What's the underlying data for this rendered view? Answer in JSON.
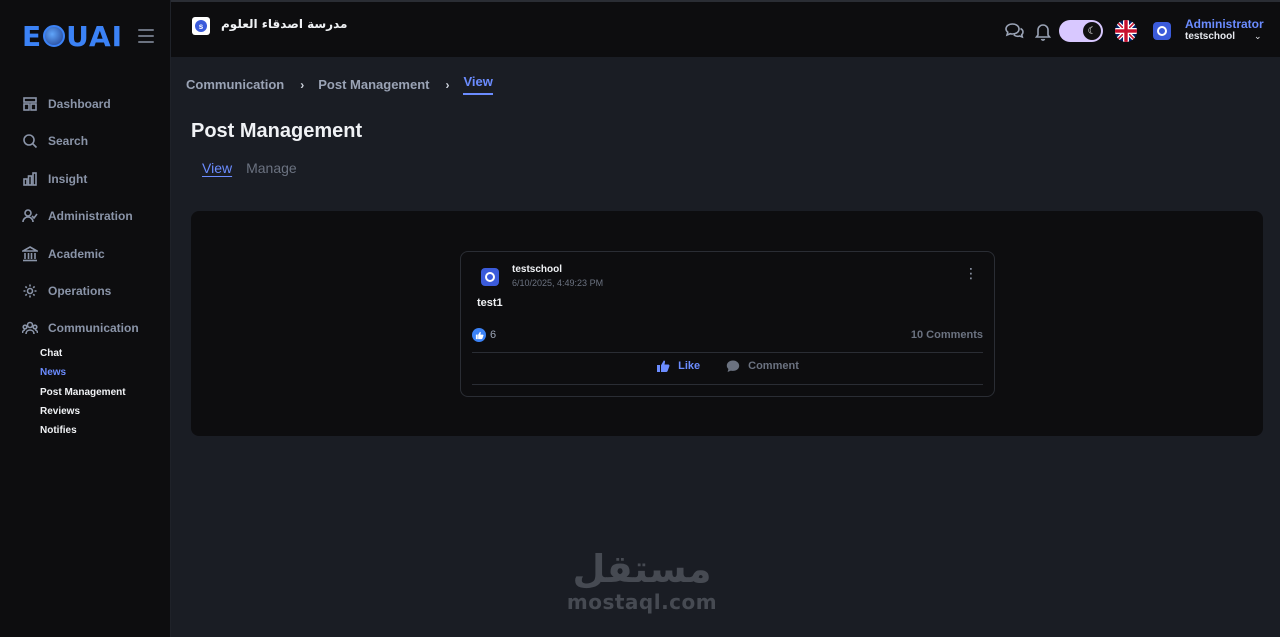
{
  "brand": {
    "logo_text_left": "E",
    "logo_text_right": "UAI"
  },
  "sidebar": {
    "items": [
      {
        "label": "Dashboard",
        "icon": "dashboard-icon"
      },
      {
        "label": "Search",
        "icon": "search-icon"
      },
      {
        "label": "Insight",
        "icon": "chart-icon"
      },
      {
        "label": "Administration",
        "icon": "user-check-icon"
      },
      {
        "label": "Academic",
        "icon": "bank-icon"
      },
      {
        "label": "Operations",
        "icon": "gear-icon"
      },
      {
        "label": "Communication",
        "icon": "users-icon"
      }
    ],
    "sub_items": [
      {
        "label": "Chat",
        "active": false
      },
      {
        "label": "News",
        "active": true
      },
      {
        "label": "Post Management",
        "active": false
      },
      {
        "label": "Reviews",
        "active": false
      },
      {
        "label": "Notifies",
        "active": false
      }
    ]
  },
  "topbar": {
    "school_name": "مدرسة اصدقاء العلوم",
    "user_role": "Administrator",
    "user_name": "testschool",
    "icons": [
      "chat-icon",
      "bell-icon",
      "moon-icon",
      "uk-flag-icon",
      "avatar-icon",
      "chevron-down-icon"
    ]
  },
  "breadcrumb": [
    "Communication",
    "Post Management",
    "View"
  ],
  "page": {
    "title": "Post Management",
    "tabs": [
      {
        "label": "View",
        "active": true
      },
      {
        "label": "Manage",
        "active": false
      }
    ]
  },
  "post": {
    "author": "testschool",
    "date": "6/10/2025, 4:49:23 PM",
    "body": "test1",
    "likes": "6",
    "comments": "10 Comments",
    "like_label": "Like",
    "comment_label": "Comment"
  },
  "watermark": {
    "arabic": "مستقل",
    "latin": "mostaql.com"
  },
  "colors": {
    "accent": "#6b8cff",
    "background": "#1a1d24",
    "panel": "#0d0d0f"
  }
}
